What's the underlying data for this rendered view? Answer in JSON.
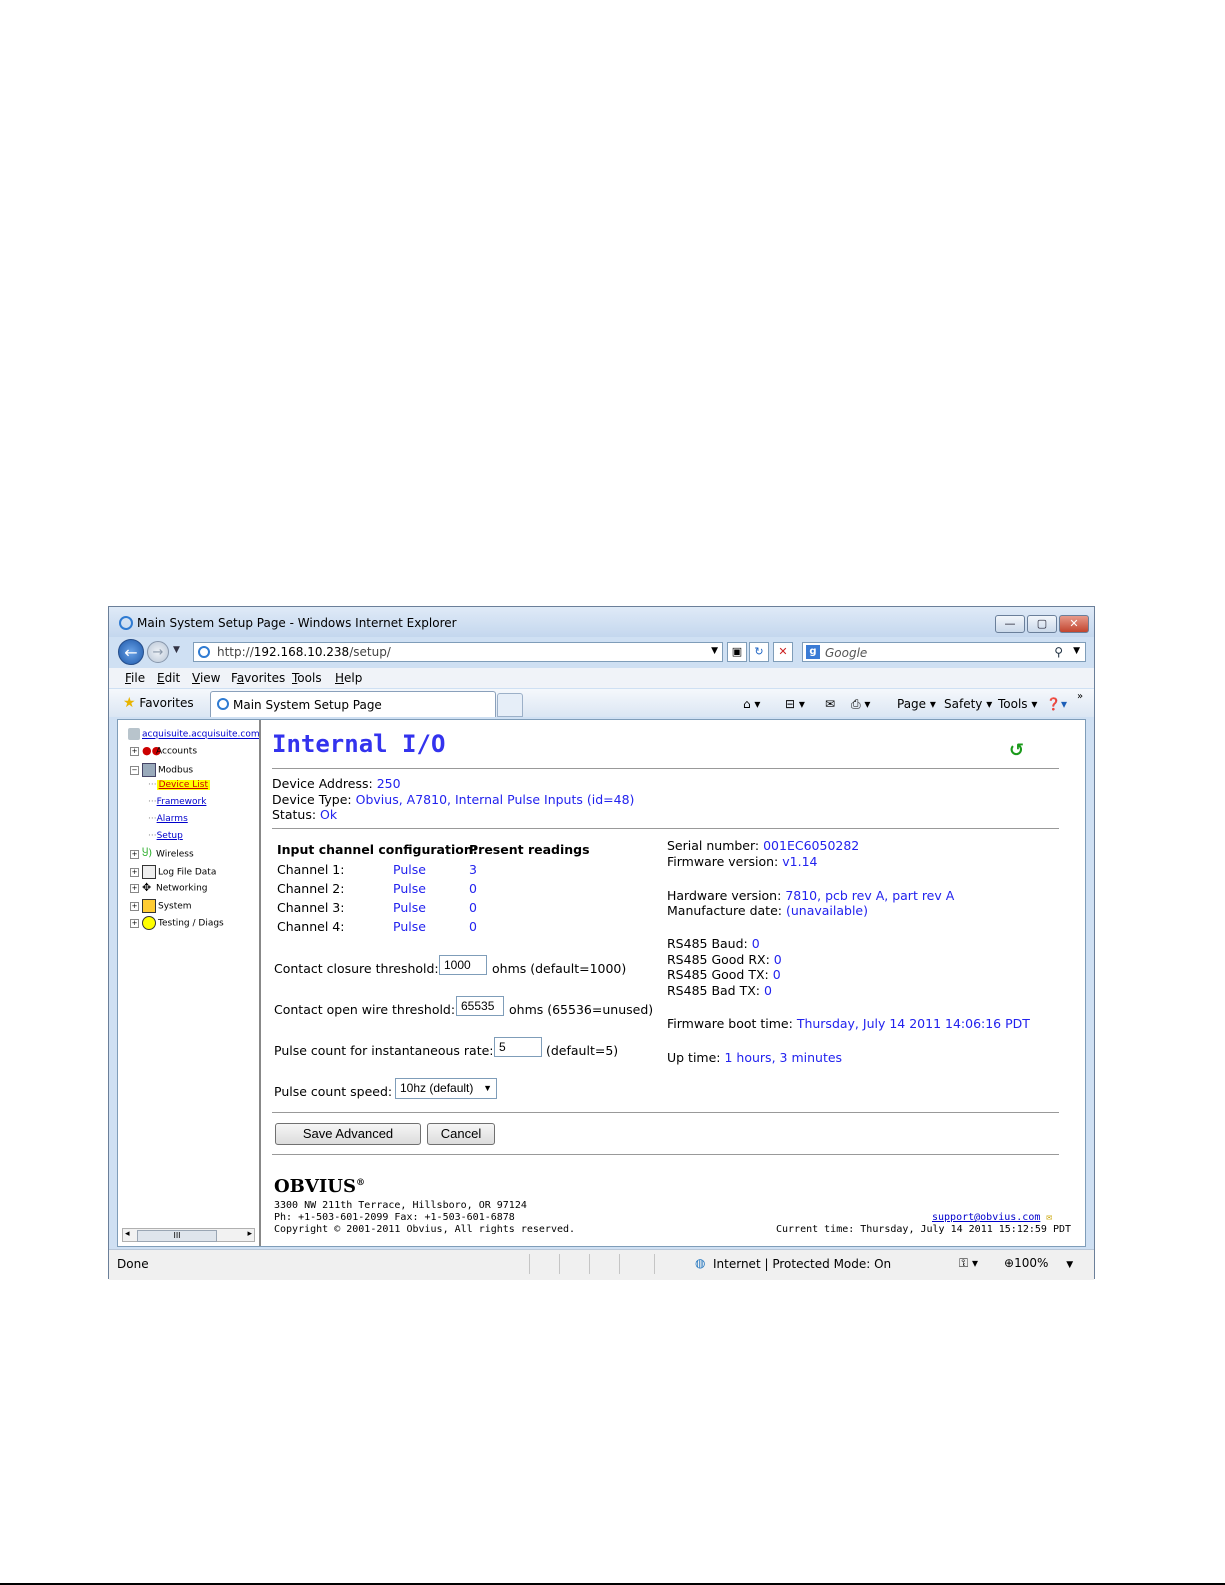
{
  "window": {
    "title": "Main System Setup Page - Windows Internet Explorer",
    "min": "—",
    "max": "▢",
    "close": "✕"
  },
  "nav": {
    "back": "←",
    "forward": "→",
    "url_prefix": "http://",
    "url_host": "192.168.10.238",
    "url_path": "/setup/",
    "search_placeholder": "Google"
  },
  "menubar": [
    {
      "label": "File",
      "key": "F",
      "rest": "ile"
    },
    {
      "label": "Edit",
      "key": "E",
      "rest": "dit"
    },
    {
      "label": "View",
      "key": "V",
      "rest": "iew"
    },
    {
      "label": "Favorites",
      "key": "F",
      "rest": "avorites",
      "pre": "Fa",
      "u": "v",
      "post": "orites"
    },
    {
      "label": "Tools",
      "key": "T",
      "rest": "ools"
    },
    {
      "label": "Help",
      "key": "H",
      "rest": "elp"
    }
  ],
  "favbar": {
    "favorites": "Favorites",
    "tab_title": "Main System Setup Page",
    "page": "Page ▾",
    "safety": "Safety ▾",
    "tools": "Tools ▾"
  },
  "tree": {
    "root": "acquisuite.acquisuite.com",
    "accounts": "Accounts",
    "modbus": "Modbus",
    "device_list": "Device List",
    "framework": "Framework",
    "alarms": "Alarms",
    "setup": "Setup",
    "wireless": "Wireless",
    "log_file_data": "Log File Data",
    "networking": "Networking",
    "system": "System",
    "testing": "Testing / Diags"
  },
  "page": {
    "title": "Internal I/O",
    "device_address_label": "Device Address:",
    "device_address": "250",
    "device_type_label": "Device Type:",
    "device_type": "Obvius, A7810, Internal Pulse Inputs (id=48)",
    "status_label": "Status:",
    "status": "Ok",
    "col_config": "Input channel configuration:",
    "col_readings": "Present readings",
    "channels": [
      {
        "label": "Channel 1:",
        "mode": "Pulse",
        "reading": "3"
      },
      {
        "label": "Channel 2:",
        "mode": "Pulse",
        "reading": "0"
      },
      {
        "label": "Channel 3:",
        "mode": "Pulse",
        "reading": "0"
      },
      {
        "label": "Channel 4:",
        "mode": "Pulse",
        "reading": "0"
      }
    ],
    "contact_closure_label": "Contact closure threshold:",
    "contact_closure_value": "1000",
    "contact_closure_unit": "ohms (default=1000)",
    "contact_open_label": "Contact open wire threshold:",
    "contact_open_value": "65535",
    "contact_open_unit": "ohms (65536=unused)",
    "pulse_rate_label": "Pulse count for instantaneous rate:",
    "pulse_rate_value": "5",
    "pulse_rate_unit": "(default=5)",
    "pulse_speed_label": "Pulse count speed:",
    "pulse_speed_value": "10hz (default)",
    "serial_label": "Serial number:",
    "serial": "001EC6050282",
    "firmware_label": "Firmware version:",
    "firmware": "v1.14",
    "hardware_label": "Hardware version:",
    "hardware": "7810, pcb rev A, part rev A",
    "manufacture_label": "Manufacture date:",
    "manufacture": "(unavailable)",
    "rs485_baud_label": "RS485 Baud:",
    "rs485_baud": "0",
    "rs485_goodrx_label": "RS485 Good RX:",
    "rs485_goodrx": "0",
    "rs485_goodtx_label": "RS485 Good TX:",
    "rs485_goodtx": "0",
    "rs485_badtx_label": "RS485 Bad TX:",
    "rs485_badtx": "0",
    "boot_label": "Firmware boot time:",
    "boot": "Thursday, July 14 2011 14:06:16 PDT",
    "uptime_label": "Up time:",
    "uptime": "1 hours, 3 minutes",
    "save_button": "Save Advanced",
    "cancel_button": "Cancel",
    "logo": "OBVIUS",
    "address_line": "3300 NW 211th Terrace, Hillsboro, OR 97124",
    "phone_line": "Ph: +1-503-601-2099 Fax: +1-503-601-6878",
    "copyright": "Copyright © 2001-2011 Obvius, All rights reserved.",
    "support_email": "support@obvius.com",
    "current_time": "Current time: Thursday, July 14 2011 15:12:59 PDT"
  },
  "status": {
    "left": "Done",
    "zone": "Internet | Protected Mode: On",
    "zoom": "100%"
  }
}
